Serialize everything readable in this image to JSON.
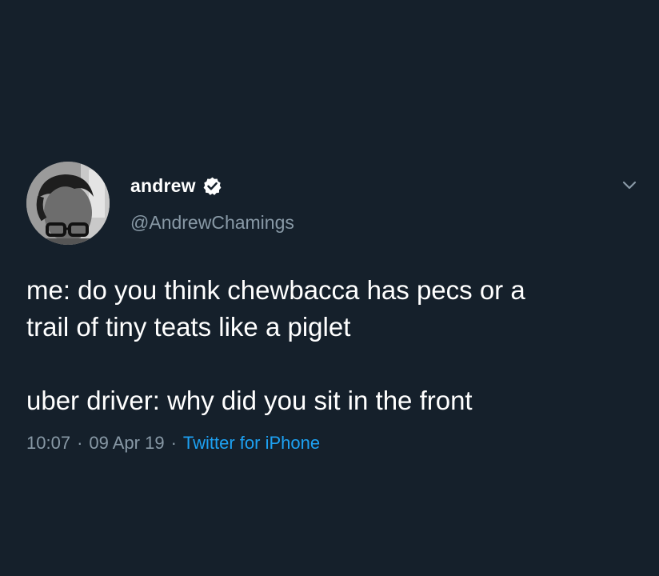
{
  "tweet": {
    "author": {
      "display_name": "andrew",
      "handle": "@AndrewChamings",
      "verified": true
    },
    "text_line_1": "me: do you think chewbacca has pecs or a",
    "text_line_2": "trail of tiny teats like a piglet",
    "text_line_3": "uber driver: why did you sit in the front",
    "time": "10:07",
    "date": "09 Apr 19",
    "separator": "·",
    "source": "Twitter for iPhone"
  },
  "colors": {
    "background": "#15202b",
    "text_primary": "#ffffff",
    "text_secondary": "#8899a6",
    "accent": "#1da1f2"
  },
  "icons": {
    "verified": "verified-badge-icon",
    "menu": "chevron-down-icon"
  }
}
